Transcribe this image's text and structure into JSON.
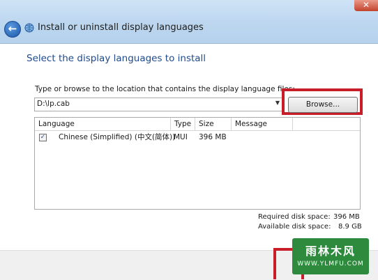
{
  "window": {
    "title": "Install or uninstall display languages",
    "close_glyph": "✕"
  },
  "nav": {
    "back_icon": "back-arrow-icon",
    "back_glyph": "←"
  },
  "page": {
    "heading": "Select the display languages to install",
    "path_label": "Type or browse to the location that contains the display language files:",
    "path_value": "D:\\lp.cab",
    "browse_label": "Browse..."
  },
  "table": {
    "columns": [
      "Language",
      "Type",
      "Size",
      "Message"
    ],
    "rows": [
      {
        "checked": true,
        "language": "Chinese (Simplified) (中文(简体))",
        "type": "MUI",
        "size": "396 MB",
        "message": ""
      }
    ]
  },
  "disk": {
    "required_label": "Required disk space:",
    "required_value": "396 MB",
    "available_label": "Available disk space:",
    "available_value": "8.9 GB"
  },
  "watermark": {
    "top": "雨林木风",
    "bottom": "WWW.YLMFU.COM"
  },
  "colors": {
    "heading": "#1f4a8c",
    "highlight": "#c81e2a",
    "titlebar": "#bcd6ef",
    "watermark": "#2e8b3d"
  }
}
